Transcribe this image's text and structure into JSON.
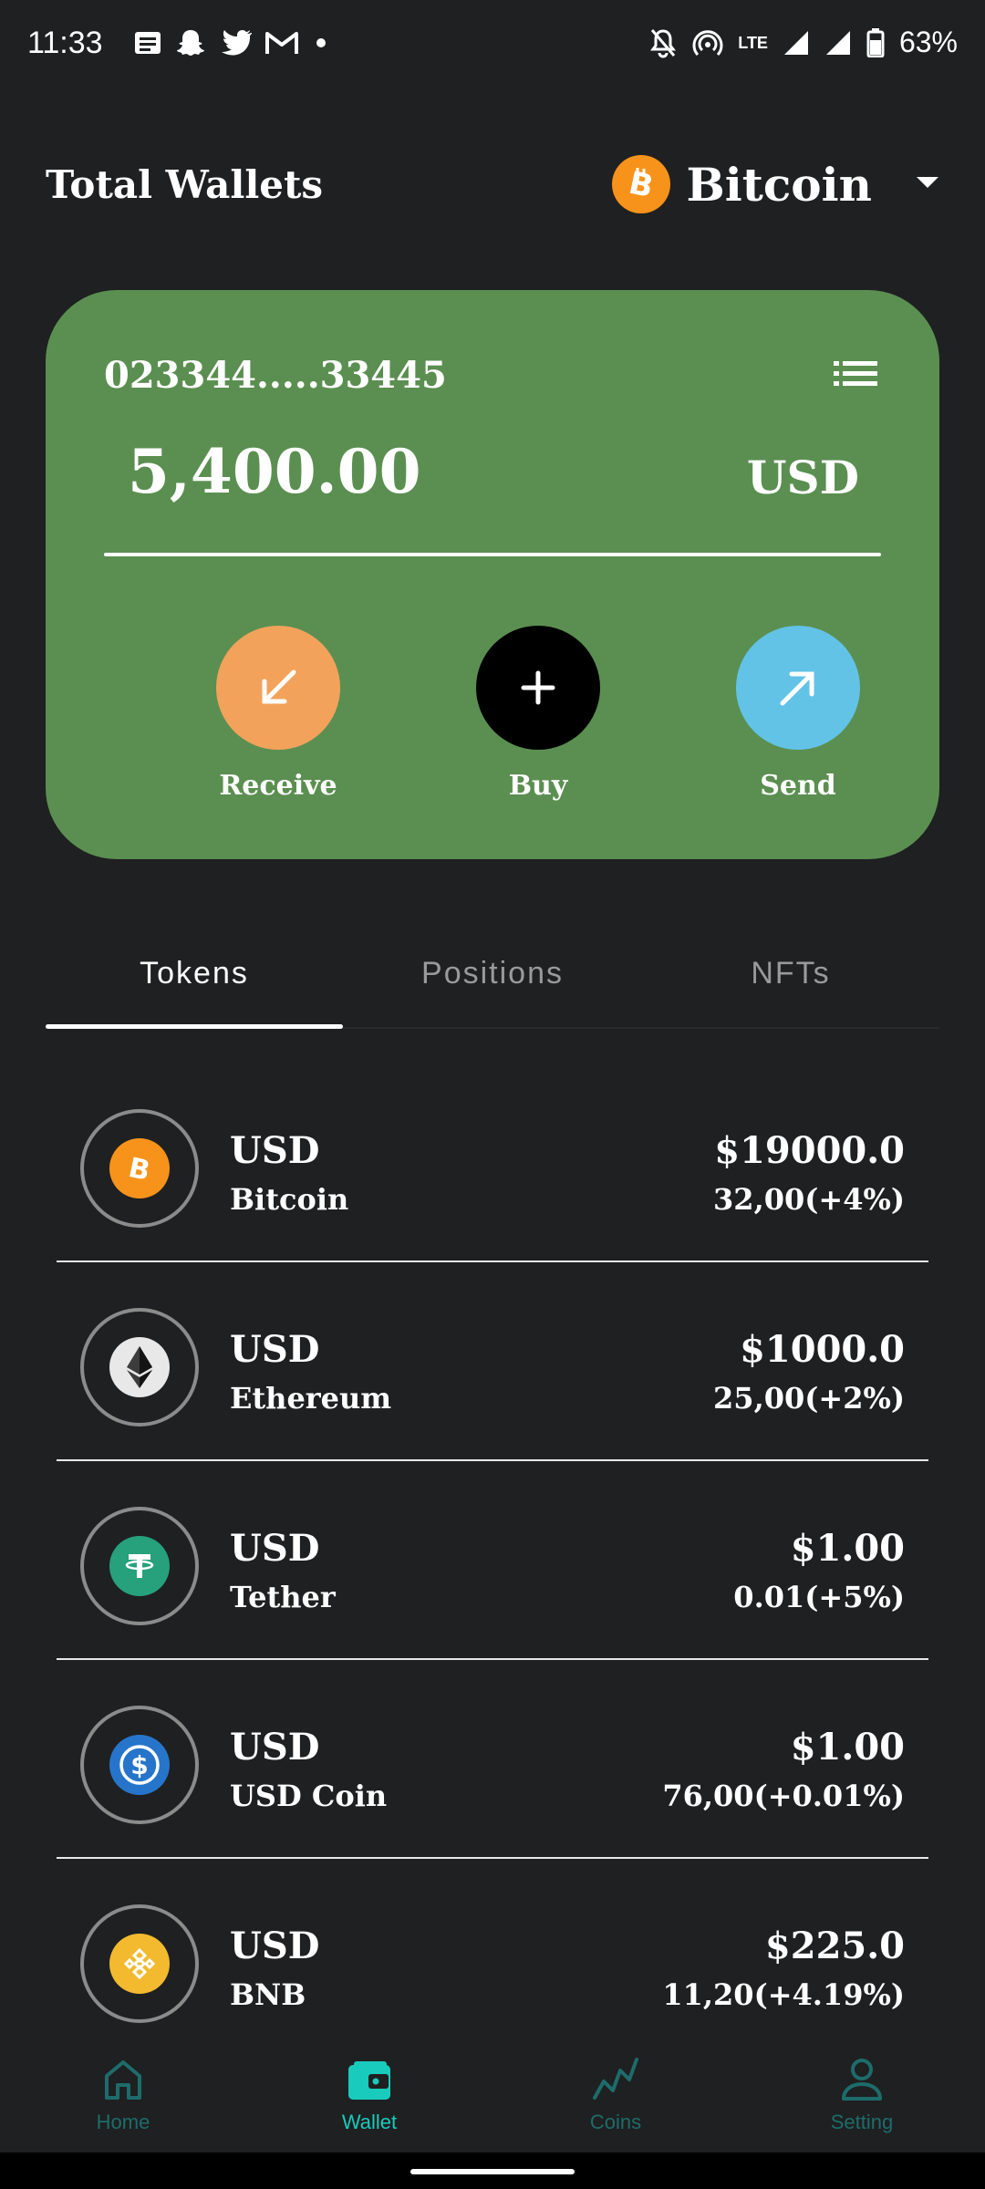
{
  "status_bar": {
    "time": "11:33",
    "network": "LTE",
    "battery": "63%",
    "left_icons": [
      "message-icon",
      "snapchat-icon",
      "twitter-icon",
      "gmail-icon",
      "dot-icon"
    ],
    "right_icons": [
      "bell-off-icon",
      "hotspot-icon",
      "lte-icon",
      "signal-icon",
      "signal-icon",
      "battery-icon"
    ]
  },
  "header": {
    "title": "Total Wallets",
    "selected_coin": "Bitcoin"
  },
  "card": {
    "address": "023344.....33445",
    "amount": "5,400.00",
    "currency": "USD",
    "color": "#5b8f51",
    "actions": {
      "receive": "Receive",
      "buy": "Buy",
      "send": "Send"
    }
  },
  "tabs": {
    "tokens": "Tokens",
    "positions": "Positions",
    "nfts": "NFTs",
    "active": "Tokens"
  },
  "tokens": [
    {
      "currency": "USD",
      "name": "Bitcoin",
      "price": "$19000.0",
      "change": "32,00(+4%)",
      "icon": "bitcoin-icon",
      "color": "#f7931a"
    },
    {
      "currency": "USD",
      "name": "Ethereum",
      "price": "$1000.0",
      "change": "25,00(+2%)",
      "icon": "ethereum-icon",
      "color": "#e8e8e8"
    },
    {
      "currency": "USD",
      "name": "Tether",
      "price": "$1.00",
      "change": "0.01(+5%)",
      "icon": "tether-icon",
      "color": "#26a17b"
    },
    {
      "currency": "USD",
      "name": "USD Coin",
      "price": "$1.00",
      "change": "76,00(+0.01%)",
      "icon": "usd-coin-icon",
      "color": "#2775ca"
    },
    {
      "currency": "USD",
      "name": "BNB",
      "price": "$225.0",
      "change": "11,20(+4.19%)",
      "icon": "bnb-icon",
      "color": "#f3ba2f"
    }
  ],
  "bottom_nav": {
    "home": "Home",
    "wallet": "Wallet",
    "coins": "Coins",
    "setting": "Setting",
    "active": "Wallet"
  }
}
